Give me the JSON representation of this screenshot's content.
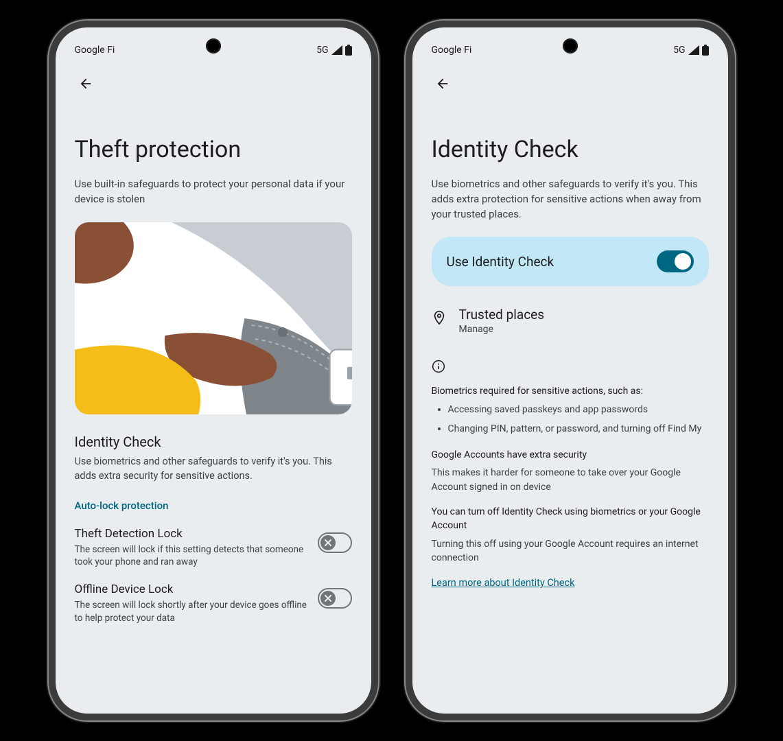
{
  "status": {
    "carrier": "Google Fi",
    "network": "5G"
  },
  "phone1": {
    "title": "Theft protection",
    "subtitle": "Use built-in safeguards to protect your personal data if your device is stolen",
    "identity_check": {
      "heading": "Identity Check",
      "body": "Use biometrics and other safeguards to verify it's you. This adds extra security for sensitive actions."
    },
    "auto_lock_label": "Auto-lock protection",
    "theft_detection": {
      "title": "Theft Detection Lock",
      "desc": "The screen will lock if this setting detects that someone took your phone and ran away"
    },
    "offline_lock": {
      "title": "Offline Device Lock",
      "desc": "The screen will lock shortly after your device goes offline to help protect your data"
    }
  },
  "phone2": {
    "title": "Identity Check",
    "subtitle": "Use biometrics and other safeguards to verify it's you. This adds extra protection for sensitive actions when away from your trusted places.",
    "toggle_label": "Use Identity Check",
    "trusted_places": {
      "title": "Trusted places",
      "sub": "Manage"
    },
    "info": {
      "biometrics_heading": "Biometrics required for sensitive actions, such as:",
      "bullets": [
        "Accessing saved passkeys and app passwords",
        "Changing PIN, pattern, or password, and turning off Find My"
      ],
      "accounts_heading": "Google Accounts have extra security",
      "accounts_body": "This makes it harder for someone to take over your Google Account signed in on device",
      "turnoff_heading": "You can turn off Identity Check using biometrics or your Google Account",
      "turnoff_body": "Turning this off using your Google Account requires an internet connection",
      "learn_more": "Learn more about Identity Check"
    }
  }
}
